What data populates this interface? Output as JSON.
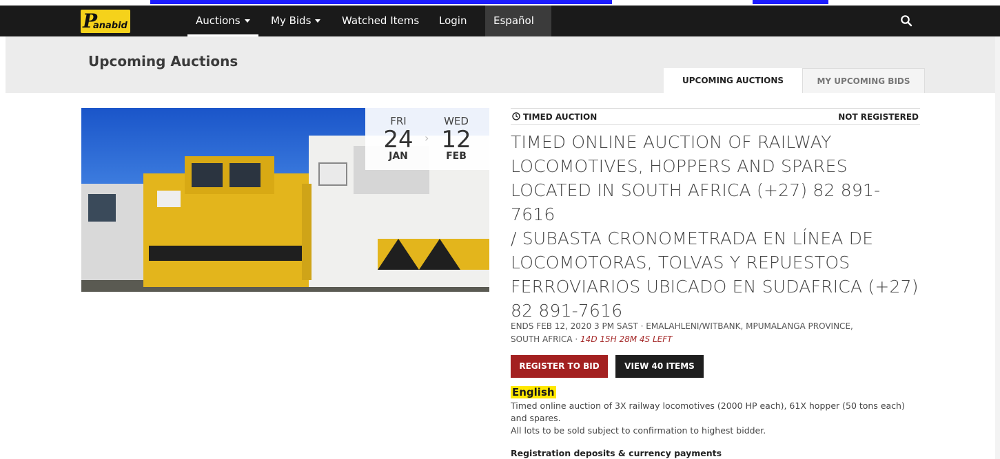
{
  "nav": {
    "logo_mark": "P",
    "logo_text": "anabid",
    "items": [
      {
        "label": "Auctions",
        "dropdown": true
      },
      {
        "label": "My Bids",
        "dropdown": true
      },
      {
        "label": "Watched Items",
        "dropdown": false
      },
      {
        "label": "Login",
        "dropdown": false
      },
      {
        "label": "Español",
        "dropdown": false
      }
    ],
    "search_icon": "search-icon"
  },
  "page": {
    "title": "Upcoming Auctions",
    "tabs": [
      {
        "label": "UPCOMING AUCTIONS",
        "active": true
      },
      {
        "label": "MY UPCOMING BIDS",
        "active": false
      }
    ]
  },
  "auction": {
    "start": {
      "dow": "FRI",
      "day": "24",
      "month": "JAN"
    },
    "end": {
      "dow": "WED",
      "day": "12",
      "month": "FEB"
    },
    "type_label": "TIMED AUCTION",
    "registration_status": "NOT REGISTERED",
    "title_lines": [
      "TIMED ONLINE AUCTION OF RAILWAY",
      "LOCOMOTIVES, HOPPERS AND SPARES",
      "LOCATED IN SOUTH AFRICA (+27) 82 891-7616",
      "/ SUBASTA CRONOMETRADA EN LÍNEA DE",
      "LOCOMOTORAS, TOLVAS Y REPUESTOS",
      "FERROVIARIOS UBICADO EN SUDAFRICA (+27)",
      "82 891-7616"
    ],
    "ends_line1": "ENDS FEB 12, 2020 3 PM SAST · EMALAHLENI/WITBANK, MPUMALANGA PROVINCE,",
    "ends_line2": "SOUTH AFRICA · ",
    "time_left": "14D 15H 28M 4S LEFT",
    "register_button": "REGISTER TO BID",
    "view_button": "VIEW 40 ITEMS",
    "language_heading": "English",
    "description_lines": [
      "Timed online auction of 3X railway locomotives (2000 HP each), 61X hopper (50 tons each)",
      "and spares.",
      "All lots to be sold subject to confirmation to highest bidder."
    ],
    "section_heading": "Registration deposits & currency payments"
  },
  "colors": {
    "nav_bg": "#1a1a1a",
    "logo_yellow": "#f5d21b",
    "register_red": "#a32020",
    "view_dark": "#1e1e1e",
    "time_left_red": "#a52a2a",
    "highlight_yellow": "#ffe800"
  }
}
